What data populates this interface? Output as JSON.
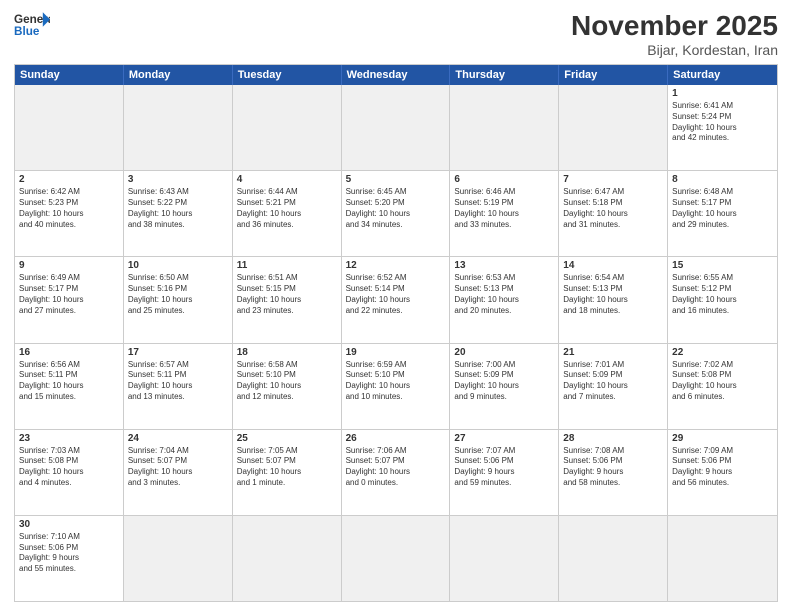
{
  "header": {
    "logo_general": "General",
    "logo_blue": "Blue",
    "month_title": "November 2025",
    "subtitle": "Bijar, Kordestan, Iran"
  },
  "days": [
    "Sunday",
    "Monday",
    "Tuesday",
    "Wednesday",
    "Thursday",
    "Friday",
    "Saturday"
  ],
  "weeks": [
    [
      {
        "num": "",
        "info": ""
      },
      {
        "num": "",
        "info": ""
      },
      {
        "num": "",
        "info": ""
      },
      {
        "num": "",
        "info": ""
      },
      {
        "num": "",
        "info": ""
      },
      {
        "num": "",
        "info": ""
      },
      {
        "num": "1",
        "info": "Sunrise: 6:41 AM\nSunset: 5:24 PM\nDaylight: 10 hours\nand 42 minutes."
      }
    ],
    [
      {
        "num": "2",
        "info": "Sunrise: 6:42 AM\nSunset: 5:23 PM\nDaylight: 10 hours\nand 40 minutes."
      },
      {
        "num": "3",
        "info": "Sunrise: 6:43 AM\nSunset: 5:22 PM\nDaylight: 10 hours\nand 38 minutes."
      },
      {
        "num": "4",
        "info": "Sunrise: 6:44 AM\nSunset: 5:21 PM\nDaylight: 10 hours\nand 36 minutes."
      },
      {
        "num": "5",
        "info": "Sunrise: 6:45 AM\nSunset: 5:20 PM\nDaylight: 10 hours\nand 34 minutes."
      },
      {
        "num": "6",
        "info": "Sunrise: 6:46 AM\nSunset: 5:19 PM\nDaylight: 10 hours\nand 33 minutes."
      },
      {
        "num": "7",
        "info": "Sunrise: 6:47 AM\nSunset: 5:18 PM\nDaylight: 10 hours\nand 31 minutes."
      },
      {
        "num": "8",
        "info": "Sunrise: 6:48 AM\nSunset: 5:17 PM\nDaylight: 10 hours\nand 29 minutes."
      }
    ],
    [
      {
        "num": "9",
        "info": "Sunrise: 6:49 AM\nSunset: 5:17 PM\nDaylight: 10 hours\nand 27 minutes."
      },
      {
        "num": "10",
        "info": "Sunrise: 6:50 AM\nSunset: 5:16 PM\nDaylight: 10 hours\nand 25 minutes."
      },
      {
        "num": "11",
        "info": "Sunrise: 6:51 AM\nSunset: 5:15 PM\nDaylight: 10 hours\nand 23 minutes."
      },
      {
        "num": "12",
        "info": "Sunrise: 6:52 AM\nSunset: 5:14 PM\nDaylight: 10 hours\nand 22 minutes."
      },
      {
        "num": "13",
        "info": "Sunrise: 6:53 AM\nSunset: 5:13 PM\nDaylight: 10 hours\nand 20 minutes."
      },
      {
        "num": "14",
        "info": "Sunrise: 6:54 AM\nSunset: 5:13 PM\nDaylight: 10 hours\nand 18 minutes."
      },
      {
        "num": "15",
        "info": "Sunrise: 6:55 AM\nSunset: 5:12 PM\nDaylight: 10 hours\nand 16 minutes."
      }
    ],
    [
      {
        "num": "16",
        "info": "Sunrise: 6:56 AM\nSunset: 5:11 PM\nDaylight: 10 hours\nand 15 minutes."
      },
      {
        "num": "17",
        "info": "Sunrise: 6:57 AM\nSunset: 5:11 PM\nDaylight: 10 hours\nand 13 minutes."
      },
      {
        "num": "18",
        "info": "Sunrise: 6:58 AM\nSunset: 5:10 PM\nDaylight: 10 hours\nand 12 minutes."
      },
      {
        "num": "19",
        "info": "Sunrise: 6:59 AM\nSunset: 5:10 PM\nDaylight: 10 hours\nand 10 minutes."
      },
      {
        "num": "20",
        "info": "Sunrise: 7:00 AM\nSunset: 5:09 PM\nDaylight: 10 hours\nand 9 minutes."
      },
      {
        "num": "21",
        "info": "Sunrise: 7:01 AM\nSunset: 5:09 PM\nDaylight: 10 hours\nand 7 minutes."
      },
      {
        "num": "22",
        "info": "Sunrise: 7:02 AM\nSunset: 5:08 PM\nDaylight: 10 hours\nand 6 minutes."
      }
    ],
    [
      {
        "num": "23",
        "info": "Sunrise: 7:03 AM\nSunset: 5:08 PM\nDaylight: 10 hours\nand 4 minutes."
      },
      {
        "num": "24",
        "info": "Sunrise: 7:04 AM\nSunset: 5:07 PM\nDaylight: 10 hours\nand 3 minutes."
      },
      {
        "num": "25",
        "info": "Sunrise: 7:05 AM\nSunset: 5:07 PM\nDaylight: 10 hours\nand 1 minute."
      },
      {
        "num": "26",
        "info": "Sunrise: 7:06 AM\nSunset: 5:07 PM\nDaylight: 10 hours\nand 0 minutes."
      },
      {
        "num": "27",
        "info": "Sunrise: 7:07 AM\nSunset: 5:06 PM\nDaylight: 9 hours\nand 59 minutes."
      },
      {
        "num": "28",
        "info": "Sunrise: 7:08 AM\nSunset: 5:06 PM\nDaylight: 9 hours\nand 58 minutes."
      },
      {
        "num": "29",
        "info": "Sunrise: 7:09 AM\nSunset: 5:06 PM\nDaylight: 9 hours\nand 56 minutes."
      }
    ],
    [
      {
        "num": "30",
        "info": "Sunrise: 7:10 AM\nSunset: 5:06 PM\nDaylight: 9 hours\nand 55 minutes."
      },
      {
        "num": "",
        "info": ""
      },
      {
        "num": "",
        "info": ""
      },
      {
        "num": "",
        "info": ""
      },
      {
        "num": "",
        "info": ""
      },
      {
        "num": "",
        "info": ""
      },
      {
        "num": "",
        "info": ""
      }
    ]
  ]
}
